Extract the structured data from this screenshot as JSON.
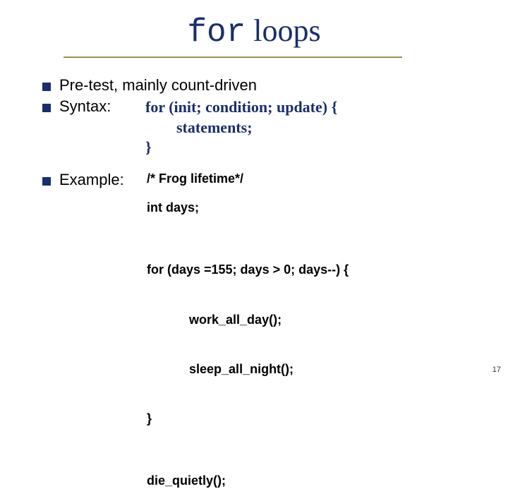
{
  "title": {
    "code": "for",
    "rest": " loops"
  },
  "bullets": {
    "pretest": "Pre-test, mainly count-driven",
    "syntax_label": "Syntax:",
    "example_label": "Example:"
  },
  "syntax": {
    "line1": "for (init; condition; update) {",
    "line2": "        statements;",
    "line3": "}"
  },
  "example": {
    "comment": "/* Frog lifetime*/",
    "decl": "int days;",
    "loop1": "for (days =155; days > 0; days--) {",
    "loop2": "            work_all_day();",
    "loop3": "            sleep_all_night();",
    "loop4": "}",
    "final": "die_quietly();"
  },
  "page_number": "17"
}
